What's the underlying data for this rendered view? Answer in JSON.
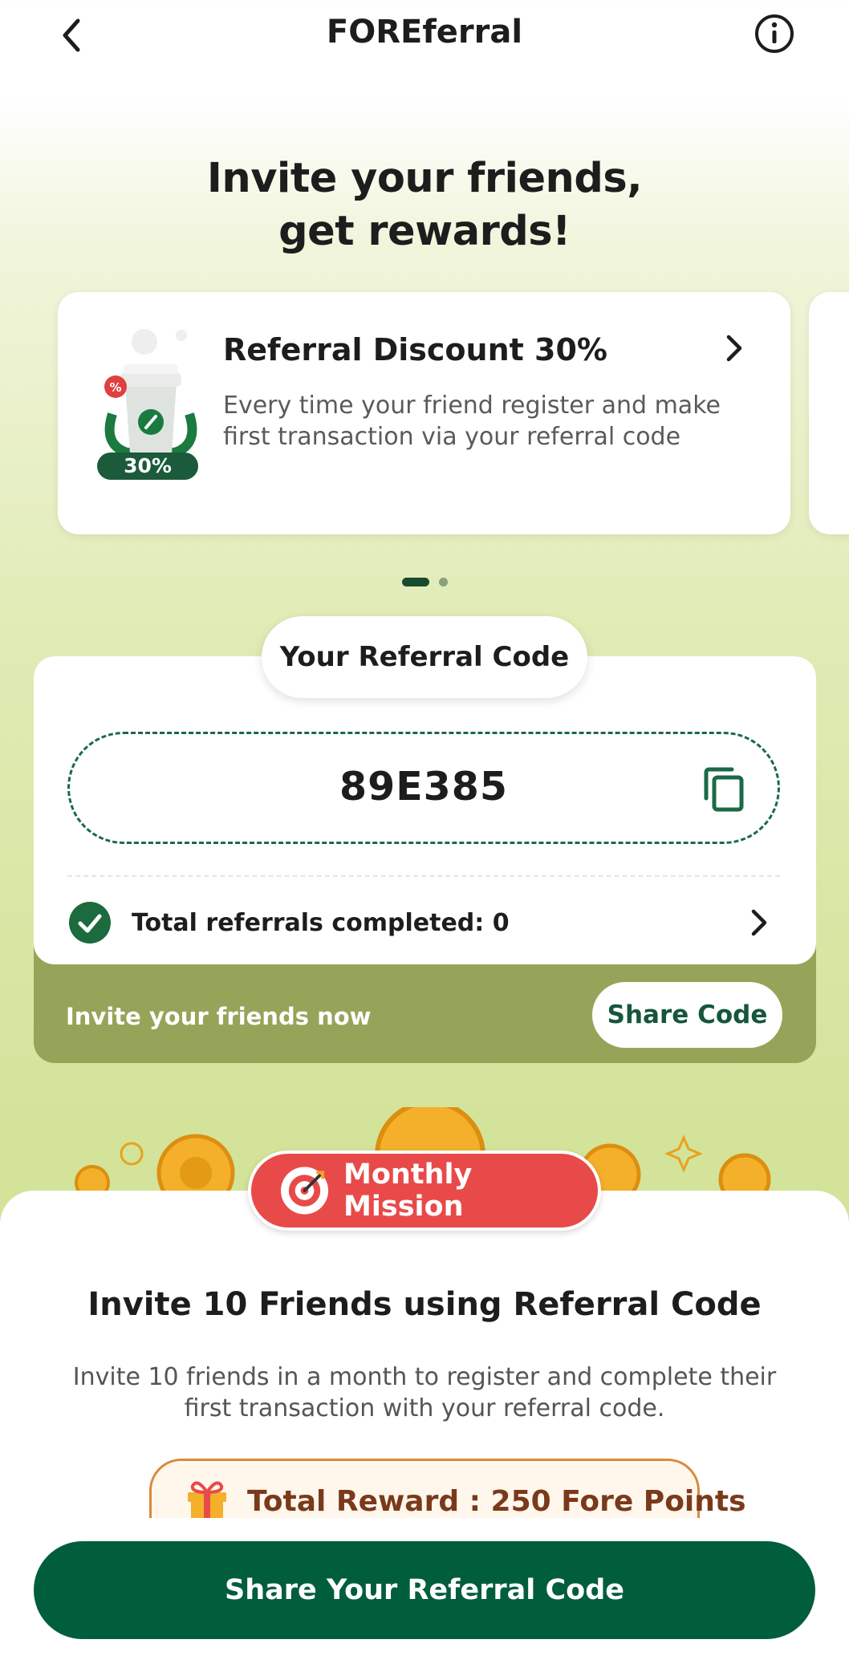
{
  "header": {
    "title": "FOREferral"
  },
  "hero": {
    "line1": "Invite your friends,",
    "line2": "get rewards!"
  },
  "promo": {
    "title": "Referral Discount 30%",
    "description": "Every time your friend register and make first transaction via your referral code",
    "badge": "30%",
    "carousel": {
      "count": 2,
      "active": 0
    }
  },
  "referral": {
    "label": "Your Referral Code",
    "code": "89E385",
    "total_label": "Total referrals completed: 0",
    "invite_text": "Invite your friends now",
    "share_code_label": "Share Code"
  },
  "mission": {
    "badge": "Monthly Mission",
    "title": "Invite 10 Friends using Referral Code",
    "description": "Invite 10 friends in a month to register and complete their first transaction with your referral code.",
    "reward": "Total Reward : 250 Fore Points"
  },
  "cta": {
    "label": "Share Your Referral Code"
  },
  "colors": {
    "brand_green": "#005e3c",
    "mission_red": "#e84a4a",
    "olive": "#96a45a"
  }
}
